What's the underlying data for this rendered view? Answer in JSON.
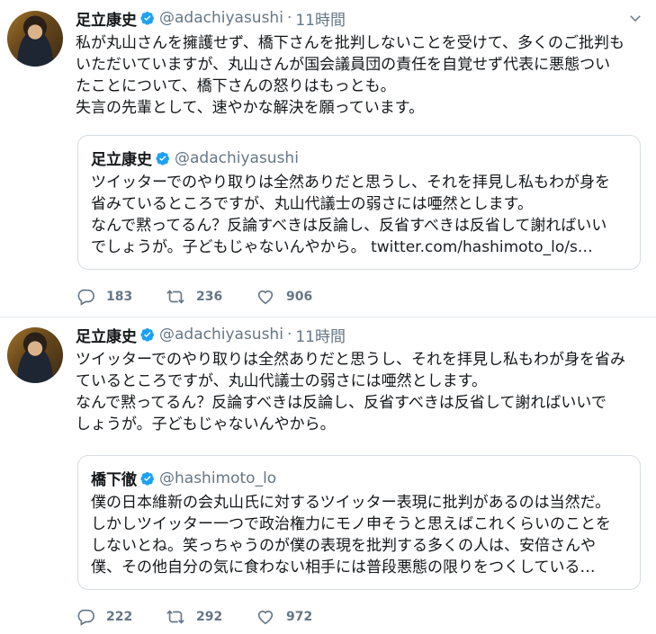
{
  "tweets": [
    {
      "author_name": "足立康史",
      "author_handle": "@adachiyasushi",
      "time": "11時間",
      "text": "私が丸山さんを擁護せず、橋下さんを批判しないことを受けて、多くのご批判も\nいただいていますが、丸山さんが国会議員団の責任を自覚せず代表に悪態つい\nたことについて、橋下さんの怒りはもっとも。\n失言の先輩として、速やかな解決を願っています。",
      "quote": {
        "author_name": "足立康史",
        "author_handle": "@adachiyasushi",
        "text_main": "ツイッターでのやり取りは全然ありだと思うし、それを拝見し私もわが身を\n省みているところですが、丸山代議士の弱さには唖然とします。\nなんで黙ってるん？反論すべきは反論し、反省すべきは反省して謝ればいい\nでしょうが。子どもじゃないんやから。 ",
        "link": "twitter.com/hashimoto_lo/s…"
      },
      "replies": "183",
      "retweets": "236",
      "likes": "906"
    },
    {
      "author_name": "足立康史",
      "author_handle": "@adachiyasushi",
      "time": "11時間",
      "text": "ツイッターでのやり取りは全然ありだと思うし、それを拝見し私もわが身を省み\nているところですが、丸山代議士の弱さには唖然とします。\nなんで黙ってるん？反論すべきは反論し、反省すべきは反省して謝ればいいで\nしょうが。子どもじゃないんやから。",
      "quote": {
        "author_name": "橋下徹",
        "author_handle": "@hashimoto_lo",
        "text_main": "僕の日本維新の会丸山氏に対するツイッター表現に批判があるのは当然だ。\nしかしツイッター一つで政治権力にモノ申そうと思えばこれくらいのことを\nしないとね。笑っちゃうのが僕の表現を批判する多くの人は、安倍さんや\n僕、その他自分の気に食わない相手には普段悪態の限りをつくしている…",
        "link": ""
      },
      "replies": "222",
      "retweets": "292",
      "likes": "972"
    }
  ],
  "separator": "·",
  "icons": {
    "verified": "verified-badge-icon",
    "caret": "chevron-down-icon",
    "reply": "reply-icon",
    "retweet": "retweet-icon",
    "like": "heart-icon"
  },
  "colors": {
    "verified_blue": "#1da1f2",
    "muted_text": "#657786",
    "border": "#e6ecf0"
  }
}
